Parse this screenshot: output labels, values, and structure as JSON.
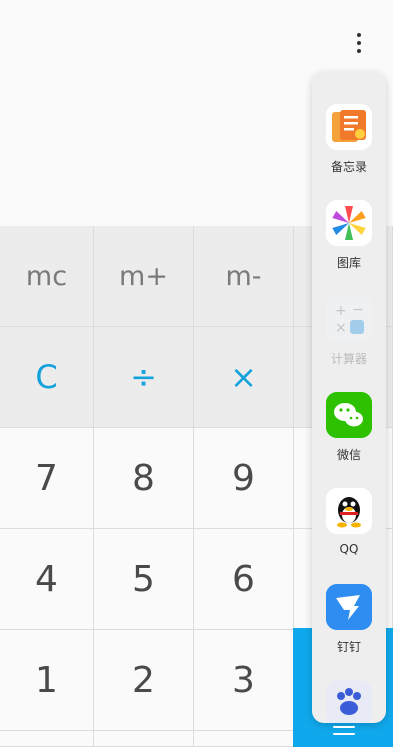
{
  "memory_row": [
    "mc",
    "m+",
    "m-"
  ],
  "operator_row": [
    "C",
    "÷",
    "×"
  ],
  "number_rows": [
    [
      "7",
      "8",
      "9"
    ],
    [
      "4",
      "5",
      "6"
    ],
    [
      "1",
      "2",
      "3"
    ]
  ],
  "sidebar_apps": [
    {
      "label": "备忘录",
      "icon": "notes-icon",
      "enabled": true
    },
    {
      "label": "图库",
      "icon": "gallery-pinwheel-icon",
      "enabled": true
    },
    {
      "label": "计算器",
      "icon": "calculator-icon",
      "enabled": false
    },
    {
      "label": "微信",
      "icon": "wechat-icon",
      "enabled": true
    },
    {
      "label": "QQ",
      "icon": "qq-penguin-icon",
      "enabled": true
    },
    {
      "label": "钉钉",
      "icon": "dingtalk-icon",
      "enabled": true
    },
    {
      "label": "",
      "icon": "baidu-paw-icon",
      "enabled": true
    }
  ],
  "colors": {
    "accent": "#14a2dc",
    "equals_key": "#10a8ec"
  }
}
